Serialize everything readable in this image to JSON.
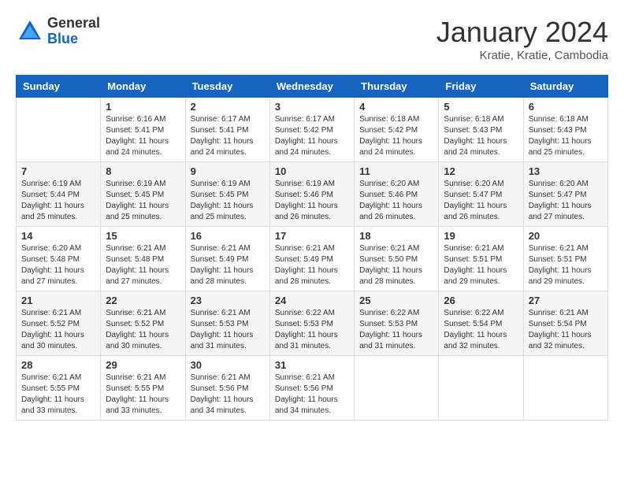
{
  "header": {
    "logo_general": "General",
    "logo_blue": "Blue",
    "month_title": "January 2024",
    "subtitle": "Kratie, Kratie, Cambodia"
  },
  "weekdays": [
    "Sunday",
    "Monday",
    "Tuesday",
    "Wednesday",
    "Thursday",
    "Friday",
    "Saturday"
  ],
  "weeks": [
    [
      {
        "day": "",
        "sunrise": "",
        "sunset": "",
        "daylight": ""
      },
      {
        "day": "1",
        "sunrise": "Sunrise: 6:16 AM",
        "sunset": "Sunset: 5:41 PM",
        "daylight": "Daylight: 11 hours and 24 minutes."
      },
      {
        "day": "2",
        "sunrise": "Sunrise: 6:17 AM",
        "sunset": "Sunset: 5:41 PM",
        "daylight": "Daylight: 11 hours and 24 minutes."
      },
      {
        "day": "3",
        "sunrise": "Sunrise: 6:17 AM",
        "sunset": "Sunset: 5:42 PM",
        "daylight": "Daylight: 11 hours and 24 minutes."
      },
      {
        "day": "4",
        "sunrise": "Sunrise: 6:18 AM",
        "sunset": "Sunset: 5:42 PM",
        "daylight": "Daylight: 11 hours and 24 minutes."
      },
      {
        "day": "5",
        "sunrise": "Sunrise: 6:18 AM",
        "sunset": "Sunset: 5:43 PM",
        "daylight": "Daylight: 11 hours and 24 minutes."
      },
      {
        "day": "6",
        "sunrise": "Sunrise: 6:18 AM",
        "sunset": "Sunset: 5:43 PM",
        "daylight": "Daylight: 11 hours and 25 minutes."
      }
    ],
    [
      {
        "day": "7",
        "sunrise": "Sunrise: 6:19 AM",
        "sunset": "Sunset: 5:44 PM",
        "daylight": "Daylight: 11 hours and 25 minutes."
      },
      {
        "day": "8",
        "sunrise": "Sunrise: 6:19 AM",
        "sunset": "Sunset: 5:45 PM",
        "daylight": "Daylight: 11 hours and 25 minutes."
      },
      {
        "day": "9",
        "sunrise": "Sunrise: 6:19 AM",
        "sunset": "Sunset: 5:45 PM",
        "daylight": "Daylight: 11 hours and 25 minutes."
      },
      {
        "day": "10",
        "sunrise": "Sunrise: 6:19 AM",
        "sunset": "Sunset: 5:46 PM",
        "daylight": "Daylight: 11 hours and 26 minutes."
      },
      {
        "day": "11",
        "sunrise": "Sunrise: 6:20 AM",
        "sunset": "Sunset: 5:46 PM",
        "daylight": "Daylight: 11 hours and 26 minutes."
      },
      {
        "day": "12",
        "sunrise": "Sunrise: 6:20 AM",
        "sunset": "Sunset: 5:47 PM",
        "daylight": "Daylight: 11 hours and 26 minutes."
      },
      {
        "day": "13",
        "sunrise": "Sunrise: 6:20 AM",
        "sunset": "Sunset: 5:47 PM",
        "daylight": "Daylight: 11 hours and 27 minutes."
      }
    ],
    [
      {
        "day": "14",
        "sunrise": "Sunrise: 6:20 AM",
        "sunset": "Sunset: 5:48 PM",
        "daylight": "Daylight: 11 hours and 27 minutes."
      },
      {
        "day": "15",
        "sunrise": "Sunrise: 6:21 AM",
        "sunset": "Sunset: 5:48 PM",
        "daylight": "Daylight: 11 hours and 27 minutes."
      },
      {
        "day": "16",
        "sunrise": "Sunrise: 6:21 AM",
        "sunset": "Sunset: 5:49 PM",
        "daylight": "Daylight: 11 hours and 28 minutes."
      },
      {
        "day": "17",
        "sunrise": "Sunrise: 6:21 AM",
        "sunset": "Sunset: 5:49 PM",
        "daylight": "Daylight: 11 hours and 28 minutes."
      },
      {
        "day": "18",
        "sunrise": "Sunrise: 6:21 AM",
        "sunset": "Sunset: 5:50 PM",
        "daylight": "Daylight: 11 hours and 28 minutes."
      },
      {
        "day": "19",
        "sunrise": "Sunrise: 6:21 AM",
        "sunset": "Sunset: 5:51 PM",
        "daylight": "Daylight: 11 hours and 29 minutes."
      },
      {
        "day": "20",
        "sunrise": "Sunrise: 6:21 AM",
        "sunset": "Sunset: 5:51 PM",
        "daylight": "Daylight: 11 hours and 29 minutes."
      }
    ],
    [
      {
        "day": "21",
        "sunrise": "Sunrise: 6:21 AM",
        "sunset": "Sunset: 5:52 PM",
        "daylight": "Daylight: 11 hours and 30 minutes."
      },
      {
        "day": "22",
        "sunrise": "Sunrise: 6:21 AM",
        "sunset": "Sunset: 5:52 PM",
        "daylight": "Daylight: 11 hours and 30 minutes."
      },
      {
        "day": "23",
        "sunrise": "Sunrise: 6:21 AM",
        "sunset": "Sunset: 5:53 PM",
        "daylight": "Daylight: 11 hours and 31 minutes."
      },
      {
        "day": "24",
        "sunrise": "Sunrise: 6:22 AM",
        "sunset": "Sunset: 5:53 PM",
        "daylight": "Daylight: 11 hours and 31 minutes."
      },
      {
        "day": "25",
        "sunrise": "Sunrise: 6:22 AM",
        "sunset": "Sunset: 5:53 PM",
        "daylight": "Daylight: 11 hours and 31 minutes."
      },
      {
        "day": "26",
        "sunrise": "Sunrise: 6:22 AM",
        "sunset": "Sunset: 5:54 PM",
        "daylight": "Daylight: 11 hours and 32 minutes."
      },
      {
        "day": "27",
        "sunrise": "Sunrise: 6:21 AM",
        "sunset": "Sunset: 5:54 PM",
        "daylight": "Daylight: 11 hours and 32 minutes."
      }
    ],
    [
      {
        "day": "28",
        "sunrise": "Sunrise: 6:21 AM",
        "sunset": "Sunset: 5:55 PM",
        "daylight": "Daylight: 11 hours and 33 minutes."
      },
      {
        "day": "29",
        "sunrise": "Sunrise: 6:21 AM",
        "sunset": "Sunset: 5:55 PM",
        "daylight": "Daylight: 11 hours and 33 minutes."
      },
      {
        "day": "30",
        "sunrise": "Sunrise: 6:21 AM",
        "sunset": "Sunset: 5:56 PM",
        "daylight": "Daylight: 11 hours and 34 minutes."
      },
      {
        "day": "31",
        "sunrise": "Sunrise: 6:21 AM",
        "sunset": "Sunset: 5:56 PM",
        "daylight": "Daylight: 11 hours and 34 minutes."
      },
      {
        "day": "",
        "sunrise": "",
        "sunset": "",
        "daylight": ""
      },
      {
        "day": "",
        "sunrise": "",
        "sunset": "",
        "daylight": ""
      },
      {
        "day": "",
        "sunrise": "",
        "sunset": "",
        "daylight": ""
      }
    ]
  ]
}
